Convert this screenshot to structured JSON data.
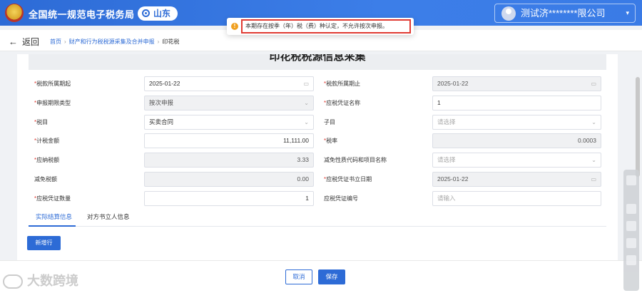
{
  "header": {
    "brand": "全国统一规范电子税务局",
    "region": "山东",
    "user": "测试济********限公司",
    "user_caret": "▾"
  },
  "toast": {
    "icon": "!",
    "message": "本期存在按季（年）税（费）种认定，不允许按次申报。"
  },
  "breadcrumb": {
    "back": "返回",
    "back_arrow": "←",
    "items": [
      "首页",
      "财产和行为税税源采集及合并申报",
      "印花税"
    ],
    "separators": [
      "›",
      "›"
    ]
  },
  "form": {
    "title": "印花税税源信息采集",
    "required_mark": "*",
    "left": [
      {
        "label": "税款所属期起",
        "required": true,
        "value": "2025-01-22",
        "icon": "📅"
      },
      {
        "label": "申报期限类型",
        "required": true,
        "value": "按次申报",
        "icon": "⌄"
      },
      {
        "label": "税目",
        "required": true,
        "value": "买卖合同",
        "icon": "⌄"
      },
      {
        "label": "计税金额",
        "required": true,
        "value": "11,111.00"
      },
      {
        "label": "应纳税额",
        "required": true,
        "value": "3.33"
      },
      {
        "label": "减免税额",
        "required": false,
        "value": "0.00"
      },
      {
        "label": "应税凭证数量",
        "required": true,
        "value": "1"
      }
    ],
    "right": [
      {
        "label": "税款所属期止",
        "required": true,
        "value": "2025-01-22",
        "icon": "📅"
      },
      {
        "label": "应税凭证名称",
        "required": true,
        "value": "1"
      },
      {
        "label": "子目",
        "required": false,
        "placeholder": "请选择",
        "icon": "⌄"
      },
      {
        "label": "税率",
        "required": true,
        "value": "0.0003"
      },
      {
        "label": "减免性质代码和项目名称",
        "required": false,
        "placeholder": "请选择",
        "icon": "⌄"
      },
      {
        "label": "应税凭证书立日期",
        "required": true,
        "value": "2025-01-22",
        "icon": "📅"
      },
      {
        "label": "应税凭证编号",
        "required": false,
        "placeholder": "请输入"
      }
    ],
    "tabs": [
      "实际结算信息",
      "对方书立人信息"
    ],
    "add_row": "新增行"
  },
  "footer": {
    "cancel": "取消",
    "save": "保存",
    "watermark": "大数跨境"
  },
  "colors": {
    "primary": "#2d6bd6",
    "required": "#e03a32",
    "warning": "#f0a020"
  }
}
